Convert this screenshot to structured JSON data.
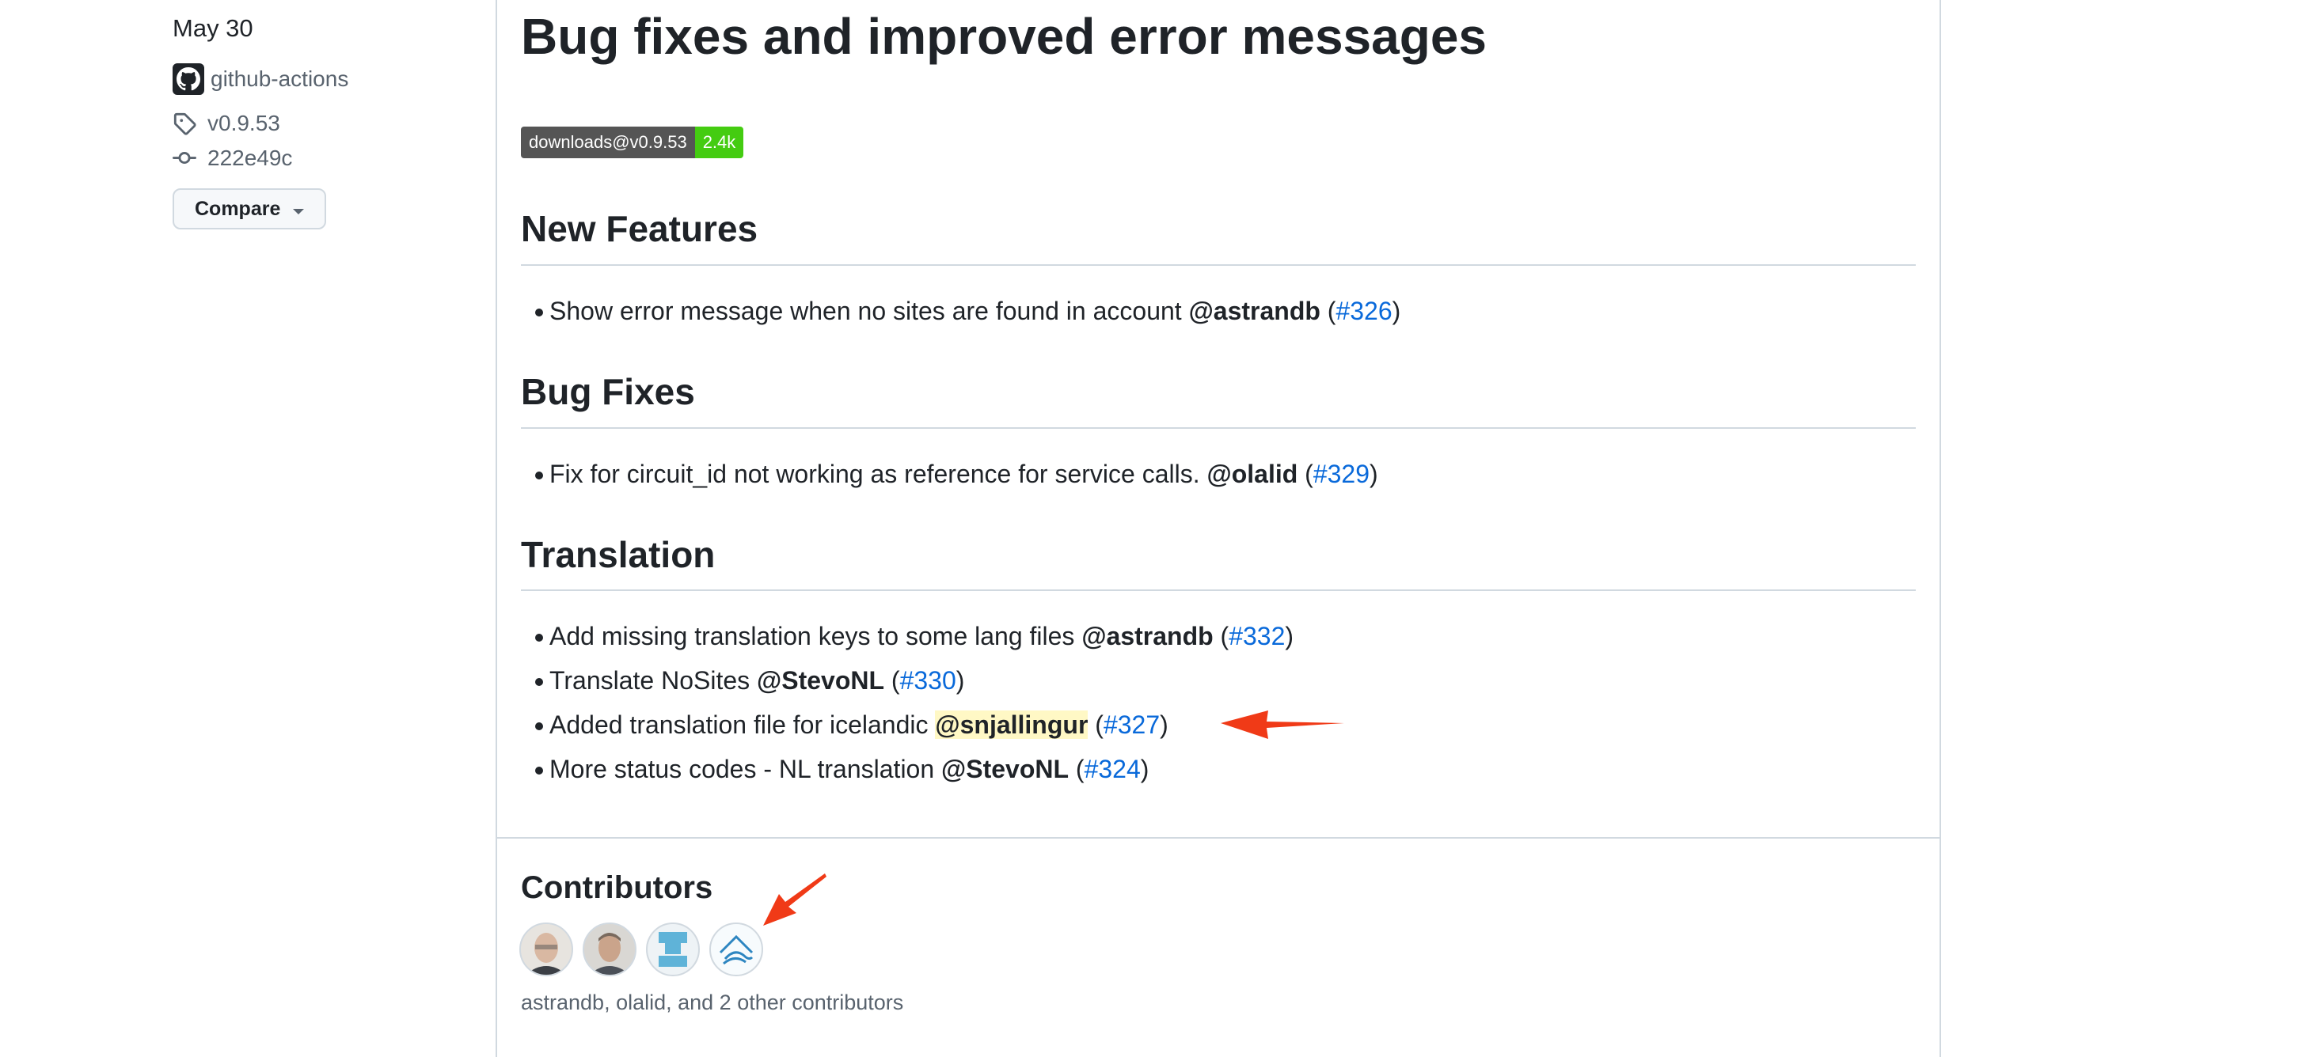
{
  "sidebar": {
    "date": "May 30",
    "author": "github-actions",
    "tag": "v0.9.53",
    "commit": "222e49c",
    "compare_label": "Compare"
  },
  "release": {
    "title": "Bug fixes and improved error messages",
    "badge": {
      "label": "downloads@v0.9.53",
      "value": "2.4k",
      "label_color": "#555555",
      "value_color": "#44cc11"
    },
    "sections": [
      {
        "heading": "New Features",
        "items": [
          {
            "text": "Show error message when no sites are found in account",
            "mention": "@astrandb",
            "pr": "#326"
          }
        ]
      },
      {
        "heading": "Bug Fixes",
        "items": [
          {
            "text": "Fix for circuit_id not working as reference for service calls.",
            "mention": "@olalid",
            "pr": "#329"
          }
        ]
      },
      {
        "heading": "Translation",
        "items": [
          {
            "text": "Add missing translation keys to some lang files",
            "mention": "@astrandb",
            "pr": "#332"
          },
          {
            "text": "Translate NoSites",
            "mention": "@StevoNL",
            "pr": "#330"
          },
          {
            "text": "Added translation file for icelandic",
            "mention": "@snjallingur",
            "pr": "#327"
          },
          {
            "text": "More status codes - NL translation",
            "mention": "@StevoNL",
            "pr": "#324"
          }
        ]
      }
    ]
  },
  "contributors": {
    "heading": "Contributors",
    "summary": "astrandb, olalid, and 2 other contributors",
    "avatars": [
      "astrandb",
      "olalid",
      "StevoNL",
      "snjallingur"
    ]
  },
  "colors": {
    "link": "#0969da",
    "highlight": "#fff8c5",
    "annotation_arrow": "#f03a17"
  }
}
